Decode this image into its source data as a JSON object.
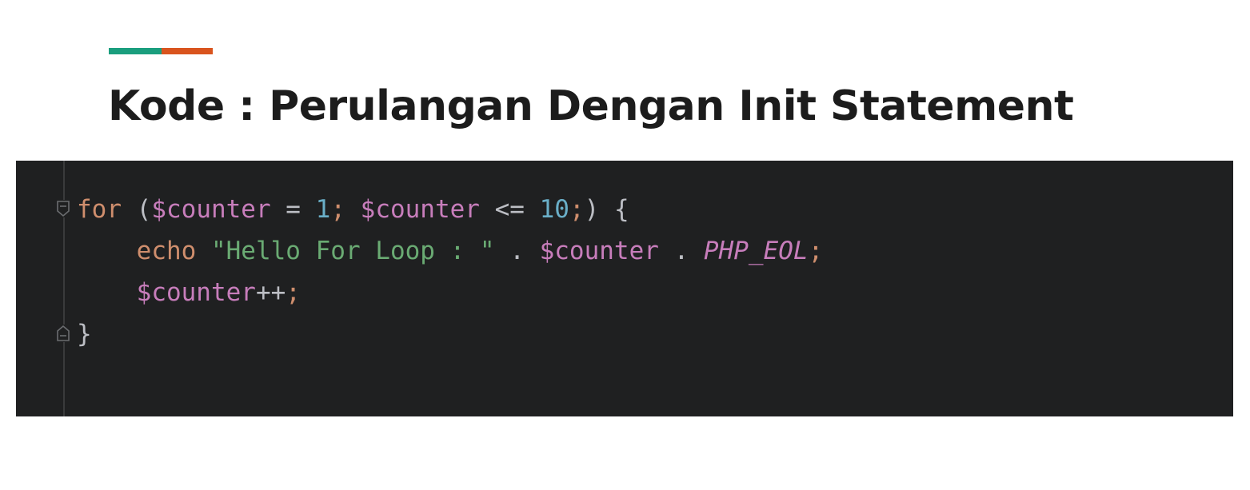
{
  "slide": {
    "title": "Kode : Perulangan Dengan Init Statement",
    "accent_colors": [
      "#1a9e7e",
      "#d9541e"
    ]
  },
  "code": {
    "lines": [
      [
        {
          "t": "for",
          "c": "kw"
        },
        {
          "t": " (",
          "c": "plain"
        },
        {
          "t": "$counter",
          "c": "var"
        },
        {
          "t": " = ",
          "c": "plain"
        },
        {
          "t": "1",
          "c": "num"
        },
        {
          "t": ";",
          "c": "punc"
        },
        {
          "t": " ",
          "c": "plain"
        },
        {
          "t": "$counter",
          "c": "var"
        },
        {
          "t": " <= ",
          "c": "plain"
        },
        {
          "t": "10",
          "c": "num"
        },
        {
          "t": ";",
          "c": "punc"
        },
        {
          "t": ") {",
          "c": "plain"
        }
      ],
      [
        {
          "t": "    ",
          "c": "plain"
        },
        {
          "t": "echo",
          "c": "kw"
        },
        {
          "t": " ",
          "c": "plain"
        },
        {
          "t": "\"Hello For Loop : \"",
          "c": "str"
        },
        {
          "t": " . ",
          "c": "plain"
        },
        {
          "t": "$counter",
          "c": "var"
        },
        {
          "t": " . ",
          "c": "plain"
        },
        {
          "t": "PHP_EOL",
          "c": "const"
        },
        {
          "t": ";",
          "c": "punc"
        }
      ],
      [
        {
          "t": "    ",
          "c": "plain"
        },
        {
          "t": "$counter",
          "c": "var"
        },
        {
          "t": "++",
          "c": "plain"
        },
        {
          "t": ";",
          "c": "punc"
        }
      ],
      [
        {
          "t": "}",
          "c": "plain"
        }
      ]
    ]
  }
}
